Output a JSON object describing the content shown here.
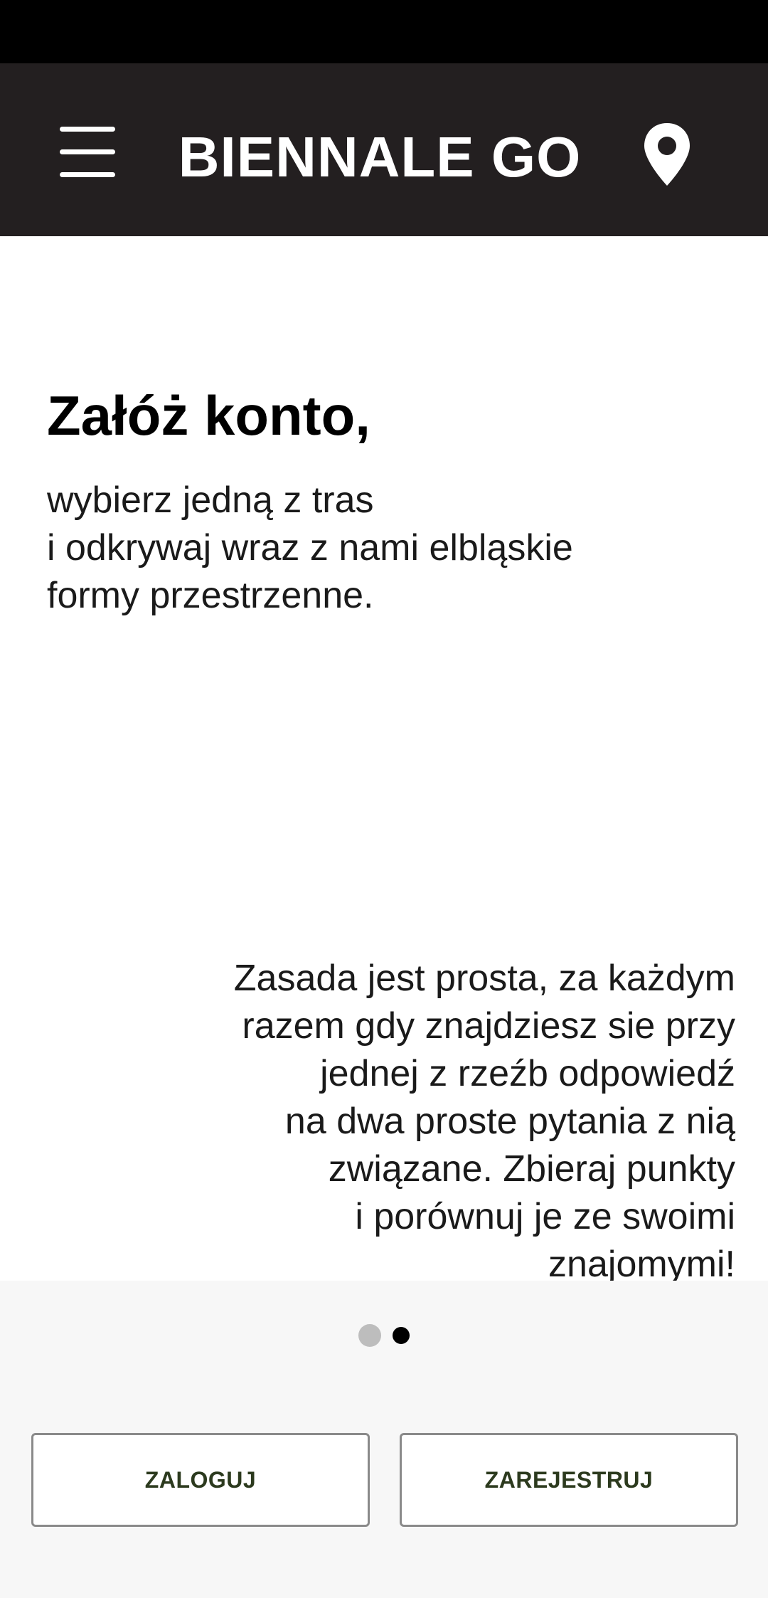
{
  "app_bar": {
    "title": "BIENNALE GO",
    "menu_icon": "hamburger-menu-icon",
    "location_icon": "map-pin-icon"
  },
  "onboarding": {
    "headline": "Załóż konto,",
    "subtext_lines": [
      "wybierz jedną z tras",
      "i odkrywaj wraz z nami elbląskie",
      "formy przestrzenne."
    ],
    "rules_lines": [
      "Zasada jest prosta, za każdym",
      "razem gdy znajdziesz sie przy",
      "jednej z rzeźb odpowiedź",
      "na dwa proste pytania z nią",
      "związane. Zbieraj punkty",
      "i porównuj je ze swoimi",
      "znajomymi!"
    ]
  },
  "pager": {
    "page_count": 2,
    "current_page": 2
  },
  "buttons": {
    "login_label": "ZALOGUJ",
    "register_label": "ZAREJESTRUJ"
  },
  "colors": {
    "app_bar": "#231f20",
    "button_text": "#2c3a1e",
    "bottom_panel": "#f7f7f7"
  }
}
